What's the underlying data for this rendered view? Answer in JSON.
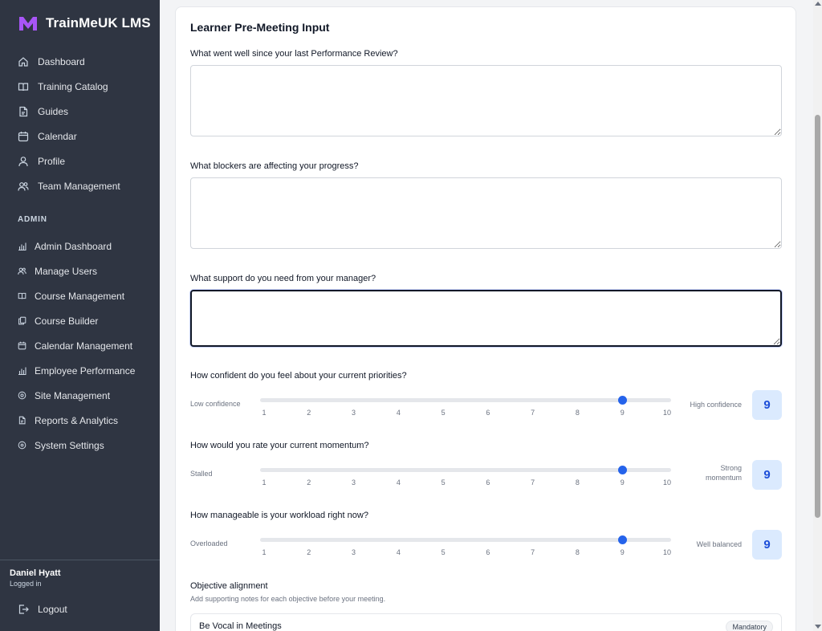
{
  "brand": {
    "name": "TrainMeUK LMS",
    "accent": "#a855f7"
  },
  "nav": {
    "items": [
      {
        "label": "Dashboard",
        "icon": "home-icon"
      },
      {
        "label": "Training Catalog",
        "icon": "book-icon"
      },
      {
        "label": "Guides",
        "icon": "document-icon"
      },
      {
        "label": "Calendar",
        "icon": "calendar-icon"
      },
      {
        "label": "Profile",
        "icon": "user-icon"
      },
      {
        "label": "Team Management",
        "icon": "users-icon"
      }
    ],
    "admin_heading": "ADMIN",
    "admin_items": [
      {
        "label": "Admin Dashboard",
        "icon": "bar-chart-icon"
      },
      {
        "label": "Manage Users",
        "icon": "users-icon"
      },
      {
        "label": "Course Management",
        "icon": "book-icon"
      },
      {
        "label": "Course Builder",
        "icon": "copy-icon"
      },
      {
        "label": "Calendar Management",
        "icon": "calendar-icon"
      },
      {
        "label": "Employee Performance",
        "icon": "bar-chart-icon"
      },
      {
        "label": "Site Management",
        "icon": "location-icon"
      },
      {
        "label": "Reports & Analytics",
        "icon": "document-icon"
      },
      {
        "label": "System Settings",
        "icon": "gear-icon"
      }
    ]
  },
  "user": {
    "name": "Daniel Hyatt",
    "status": "Logged in",
    "logout_label": "Logout"
  },
  "form": {
    "title": "Learner Pre-Meeting Input",
    "q1": {
      "label": "What went well since your last Performance Review?",
      "value": ""
    },
    "q2": {
      "label": "What blockers are affecting your progress?",
      "value": ""
    },
    "q3": {
      "label": "What support do you need from your manager?",
      "value": ""
    },
    "sliders": [
      {
        "label": "How confident do you feel about your current priorities?",
        "left": "Low confidence",
        "right": "High confidence",
        "value": 9,
        "min": 1,
        "max": 10
      },
      {
        "label": "How would you rate your current momentum?",
        "left": "Stalled",
        "right": "Strong momentum",
        "value": 9,
        "min": 1,
        "max": 10
      },
      {
        "label": "How manageable is your workload right now?",
        "left": "Overloaded",
        "right": "Well balanced",
        "value": 9,
        "min": 1,
        "max": 10
      }
    ],
    "ticks": [
      "1",
      "2",
      "3",
      "4",
      "5",
      "6",
      "7",
      "8",
      "9",
      "10"
    ],
    "objectives": {
      "title": "Objective alignment",
      "subtitle": "Add supporting notes for each objective before your meeting.",
      "items": [
        {
          "name": "Be Vocal in Meetings",
          "badge": "Mandatory"
        }
      ]
    }
  },
  "colors": {
    "sidebar_bg": "#2f3542",
    "slider_accent": "#2563eb",
    "value_bg": "#dbeafe"
  }
}
